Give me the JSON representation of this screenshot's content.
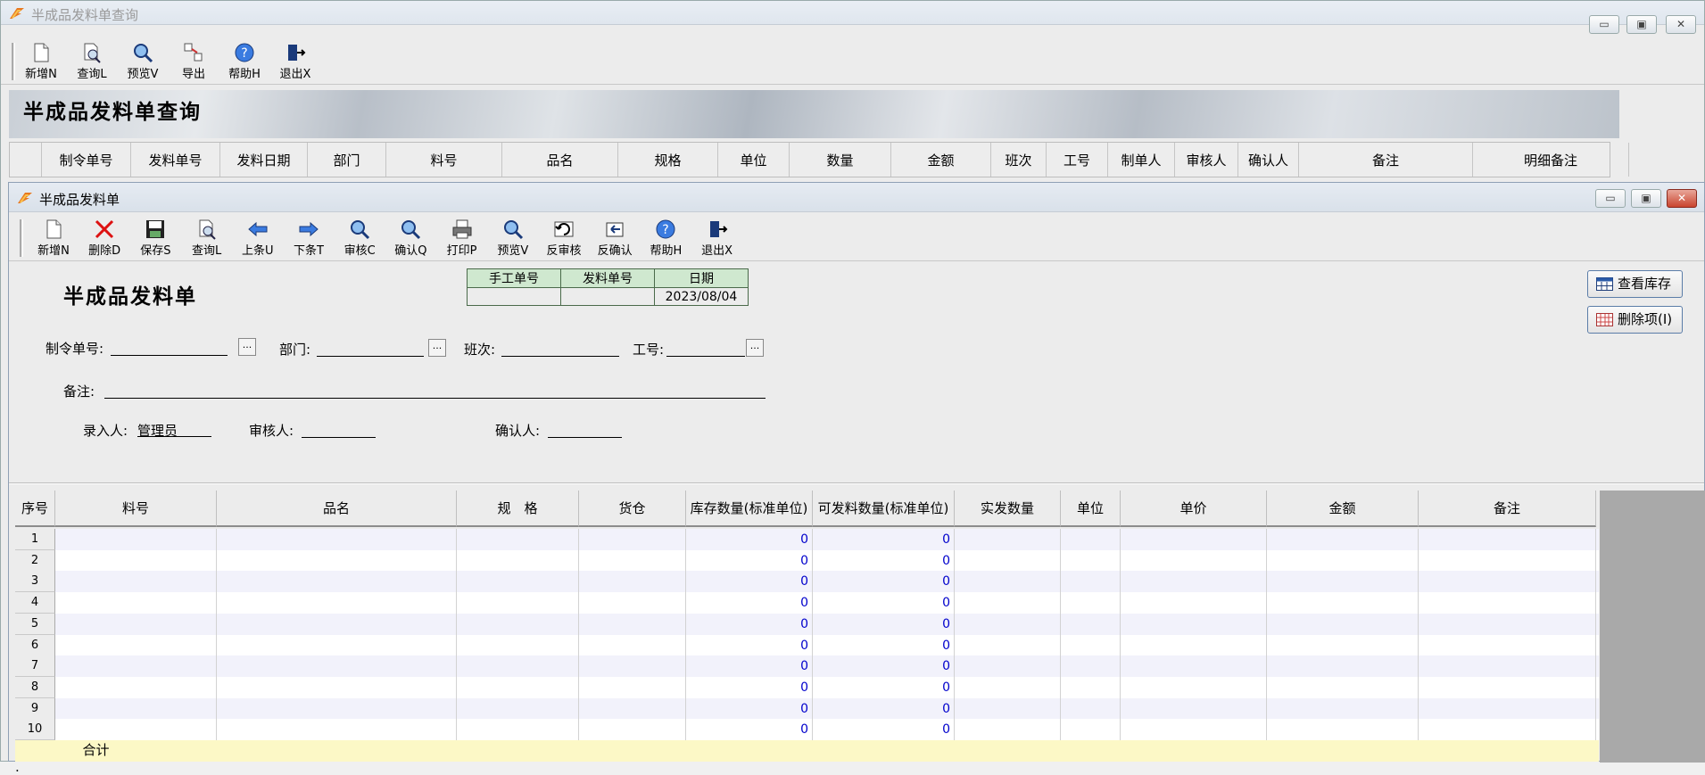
{
  "outer": {
    "title": "半成品发料单查询",
    "toolbar": [
      {
        "label": "新增N",
        "icon": "new-doc-icon"
      },
      {
        "label": "查询L",
        "icon": "query-doc-icon"
      },
      {
        "label": "预览V",
        "icon": "preview-magnifier-icon"
      },
      {
        "label": "导出",
        "icon": "export-icon"
      },
      {
        "label": "帮助H",
        "icon": "help-icon"
      },
      {
        "label": "退出X",
        "icon": "exit-icon"
      }
    ],
    "banner_title": "半成品发料单查询",
    "columns": [
      "制令单号",
      "发料单号",
      "发料日期",
      "部门",
      "料号",
      "品名",
      "规格",
      "单位",
      "数量",
      "金额",
      "班次",
      "工号",
      "制单人",
      "审核人",
      "确认人",
      "备注",
      "明细备注"
    ]
  },
  "inner": {
    "title": "半成品发料单",
    "toolbar": [
      {
        "label": "新增N",
        "icon": "new-doc-icon"
      },
      {
        "label": "删除D",
        "icon": "delete-x-icon"
      },
      {
        "label": "保存S",
        "icon": "save-disk-icon"
      },
      {
        "label": "查询L",
        "icon": "query-doc-icon"
      },
      {
        "label": "上条U",
        "icon": "prev-arrow-icon"
      },
      {
        "label": "下条T",
        "icon": "next-arrow-icon"
      },
      {
        "label": "审核C",
        "icon": "audit-magnifier-icon"
      },
      {
        "label": "确认Q",
        "icon": "confirm-magnifier-icon"
      },
      {
        "label": "打印P",
        "icon": "printer-icon"
      },
      {
        "label": "预览V",
        "icon": "preview-magnifier-icon"
      },
      {
        "label": "反审核",
        "icon": "unaudit-icon"
      },
      {
        "label": "反确认",
        "icon": "unconfirm-icon"
      },
      {
        "label": "帮助H",
        "icon": "help-icon"
      },
      {
        "label": "退出X",
        "icon": "exit-icon"
      }
    ],
    "form_title": "半成品发料单",
    "header_table": {
      "manual_no_label": "手工单号",
      "issue_no_label": "发料单号",
      "date_label": "日期",
      "manual_no": "",
      "issue_no": "",
      "date": "2023/08/04"
    },
    "fields": {
      "order_no_label": "制令单号:",
      "order_no": "",
      "dept_label": "部门:",
      "dept": "",
      "shift_label": "班次:",
      "shift": "",
      "worker_label": "工号:",
      "worker": "",
      "remark_label": "备注:",
      "remark": "",
      "entered_by_label": "录入人:",
      "entered_by": "管理员",
      "auditor_label": "审核人:",
      "auditor": "",
      "confirmer_label": "确认人:",
      "confirmer": ""
    },
    "side_buttons": {
      "view_stock": "查看库存",
      "delete_item": "删除项(I)"
    },
    "grid": {
      "columns": [
        "序号",
        "料号",
        "品名",
        "规　格",
        "货仓",
        "库存数量(标准单位)",
        "可发料数量(标准单位)",
        "实发数量",
        "单位",
        "单价",
        "金额",
        "备注"
      ],
      "rows": [
        {
          "no": "1",
          "stock": "0",
          "avail": "0"
        },
        {
          "no": "2",
          "stock": "0",
          "avail": "0"
        },
        {
          "no": "3",
          "stock": "0",
          "avail": "0"
        },
        {
          "no": "4",
          "stock": "0",
          "avail": "0"
        },
        {
          "no": "5",
          "stock": "0",
          "avail": "0"
        },
        {
          "no": "6",
          "stock": "0",
          "avail": "0"
        },
        {
          "no": "7",
          "stock": "0",
          "avail": "0"
        },
        {
          "no": "8",
          "stock": "0",
          "avail": "0"
        },
        {
          "no": "9",
          "stock": "0",
          "avail": "0"
        },
        {
          "no": "10",
          "stock": "0",
          "avail": "0"
        }
      ],
      "total_label": "合计",
      "total_amount": "."
    }
  }
}
